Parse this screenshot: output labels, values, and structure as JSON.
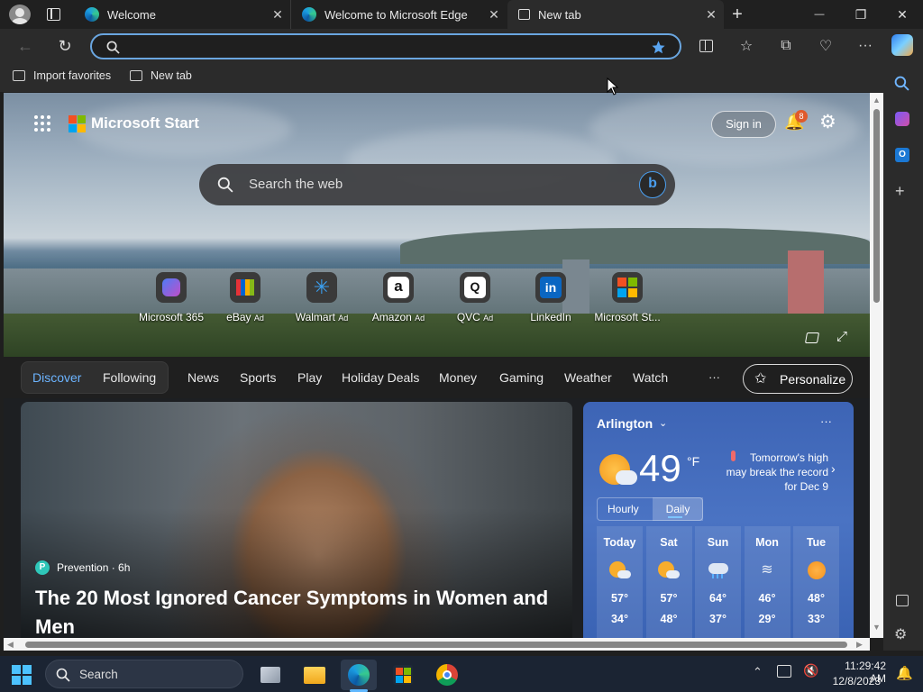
{
  "tabs": [
    {
      "title": "Welcome",
      "close": "✕"
    },
    {
      "title": "Welcome to Microsoft Edge",
      "close": "✕"
    },
    {
      "title": "New tab",
      "close": "✕"
    }
  ],
  "window_buttons": {
    "new_tab": "+",
    "minimize": "—",
    "restore": "❐",
    "close": "✕"
  },
  "favorites": {
    "import": "Import favorites",
    "newtab": "New tab"
  },
  "msn": {
    "brand": "Microsoft Start",
    "signin": "Sign in",
    "notification_count": "8",
    "search_placeholder": "Search the web",
    "quick_links": [
      {
        "label": "Microsoft 365",
        "ad": ""
      },
      {
        "label": "eBay",
        "ad": "Ad"
      },
      {
        "label": "Walmart",
        "ad": "Ad"
      },
      {
        "label": "Amazon",
        "ad": "Ad"
      },
      {
        "label": "QVC",
        "ad": "Ad"
      },
      {
        "label": "LinkedIn",
        "ad": ""
      },
      {
        "label": "Microsoft St...",
        "ad": ""
      }
    ],
    "nav": [
      "Discover",
      "Following",
      "News",
      "Sports",
      "Play",
      "Holiday Deals",
      "Money",
      "Gaming",
      "Weather",
      "Watch"
    ],
    "more": "···",
    "personalize": "Personalize",
    "article": {
      "source_initial": "P",
      "source": "Prevention · 6h",
      "headline": "The 20 Most Ignored Cancer Symptoms in Women and Men"
    },
    "weather": {
      "location": "Arlington",
      "temp": "49",
      "unit": "°F",
      "note": "Tomorrow's high may break the record for Dec 9",
      "toggle": [
        "Hourly",
        "Daily"
      ],
      "days": [
        {
          "day": "Today",
          "icon": "partly-cloudy-icon",
          "high": "57°",
          "low": "34°"
        },
        {
          "day": "Sat",
          "icon": "partly-cloudy-icon",
          "high": "57°",
          "low": "48°"
        },
        {
          "day": "Sun",
          "icon": "rain-icon",
          "high": "64°",
          "low": "37°"
        },
        {
          "day": "Mon",
          "icon": "wind-icon",
          "high": "46°",
          "low": "29°"
        },
        {
          "day": "Tue",
          "icon": "sunny-icon",
          "high": "48°",
          "low": "33°"
        }
      ]
    }
  },
  "taskbar": {
    "search": "Search",
    "time": "11:29:42 AM",
    "date": "12/8/2023"
  }
}
